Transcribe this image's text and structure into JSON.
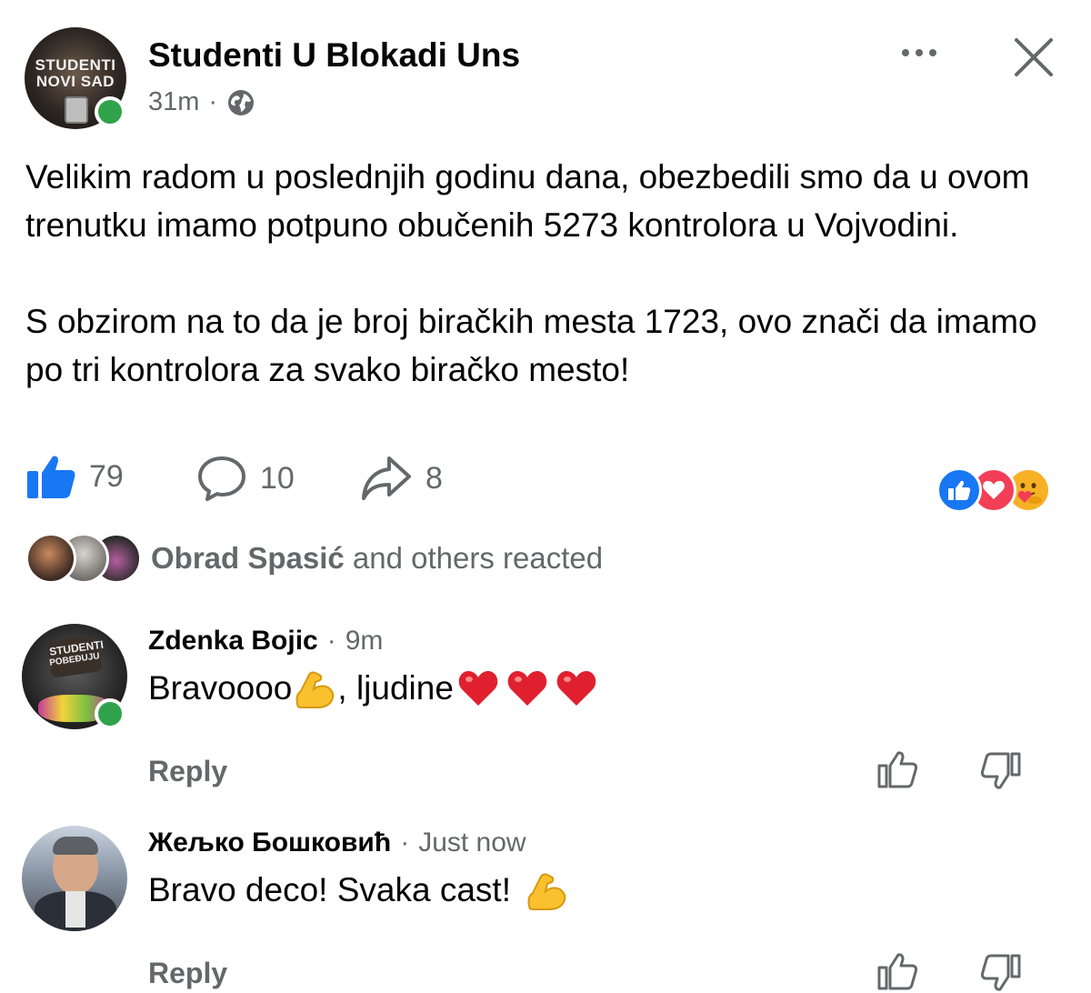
{
  "post": {
    "page_name": "Studenti U Blokadi Uns",
    "time": "31m",
    "separator": "·",
    "avatar_text_line1": "STUDENTI",
    "avatar_text_line2": "NOVI SAD",
    "paragraph1": "Velikim radom u poslednjih godinu dana, obezbedili smo da u ovom trenutku imamo potpuno obučenih 5273 kontrolora u Vojvodini.",
    "paragraph2": "S obzirom na to da je broj biračkih mesta 1723, ovo znači da imamo po tri kontrolora za svako biračko mesto!"
  },
  "actions": {
    "like_count": "79",
    "comment_count": "10",
    "share_count": "8"
  },
  "reactions": {
    "reactor_name": "Obrad Spasić",
    "reactor_suffix": "and others reacted"
  },
  "comments": [
    {
      "name": "Zdenka Bojic",
      "time": "9m",
      "separator": "·",
      "text_part1": "Bravoooo",
      "text_part2": ", ljudine",
      "avatar_text_line1": "STUDENTI",
      "avatar_text_line2": "POBEĐUJU",
      "reply_label": "Reply"
    },
    {
      "name": "Жељко Бошковић",
      "time": "Just now",
      "separator": "·",
      "text_part1": "Bravo deco! Svaka cast!",
      "reply_label": "Reply"
    }
  ],
  "icons": {
    "globe": "globe-icon",
    "more": "more-options-icon",
    "close": "close-icon",
    "like": "like-icon",
    "comment": "comment-icon",
    "share": "share-icon"
  },
  "colors": {
    "accent_blue": "#1877f2",
    "secondary_text": "#65676b",
    "online_green": "#31a24c",
    "love_red": "#f33e58"
  }
}
